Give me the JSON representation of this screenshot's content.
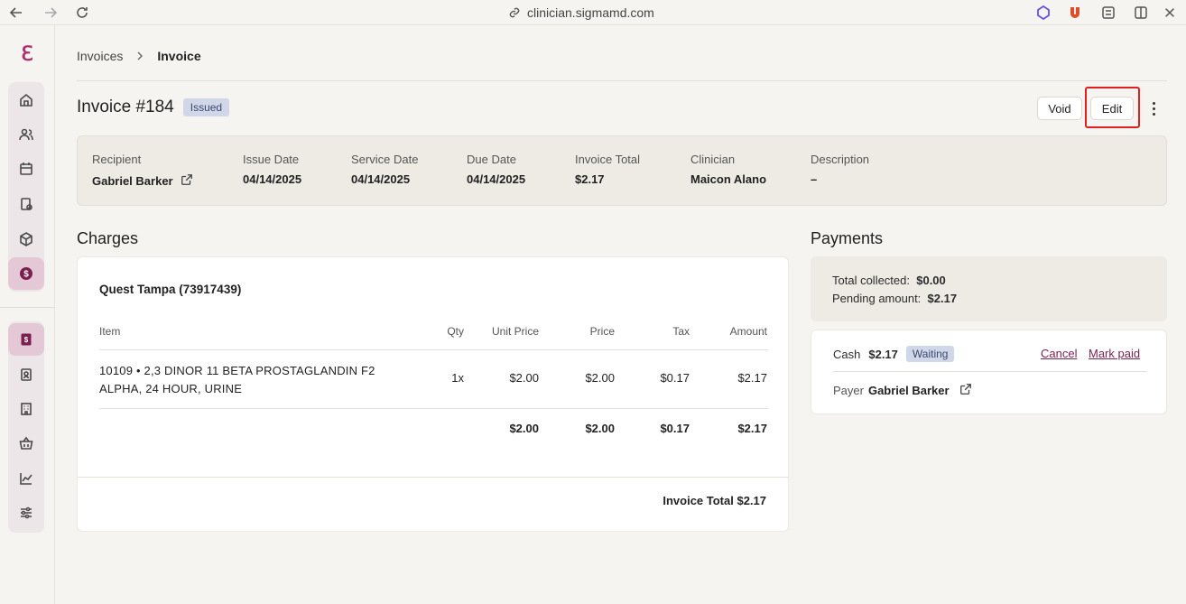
{
  "browser": {
    "url": "clinician.sigmamd.com"
  },
  "breadcrumb": {
    "parent": "Invoices",
    "current": "Invoice"
  },
  "header": {
    "title": "Invoice #184",
    "status": "Issued",
    "void_label": "Void",
    "edit_label": "Edit"
  },
  "summary": {
    "recipient_label": "Recipient",
    "recipient": "Gabriel Barker",
    "issue_date_label": "Issue Date",
    "issue_date": "04/14/2025",
    "service_date_label": "Service Date",
    "service_date": "04/14/2025",
    "due_date_label": "Due Date",
    "due_date": "04/14/2025",
    "total_label": "Invoice Total",
    "total": "$2.17",
    "clinician_label": "Clinician",
    "clinician": "Maicon Alano",
    "description_label": "Description",
    "description": "–"
  },
  "charges": {
    "title": "Charges",
    "lab": "Quest Tampa (73917439)",
    "columns": [
      "Item",
      "Qty",
      "Unit Price",
      "Price",
      "Tax",
      "Amount"
    ],
    "rows": [
      {
        "item_line1": "10109 • 2,3 DINOR 11 BETA PROSTAGLANDIN F2",
        "item_line2": "ALPHA, 24 HOUR, URINE",
        "qty": "1x",
        "unit_price": "$2.00",
        "price": "$2.00",
        "tax": "$0.17",
        "amount": "$2.17"
      }
    ],
    "totals": {
      "unit_price": "$2.00",
      "price": "$2.00",
      "tax": "$0.17",
      "amount": "$2.17"
    },
    "invoice_total": "Invoice Total $2.17"
  },
  "payments": {
    "title": "Payments",
    "collected_label": "Total collected:",
    "collected": "$0.00",
    "pending_label": "Pending amount:",
    "pending": "$2.17",
    "entry": {
      "method": "Cash",
      "amount": "$2.17",
      "status": "Waiting",
      "cancel_label": "Cancel",
      "mark_paid_label": "Mark paid",
      "payer_label": "Payer",
      "payer": "Gabriel Barker"
    }
  },
  "colors": {
    "brand": "#b0306a",
    "link": "#7a2350",
    "highlight": "#e0201e"
  }
}
